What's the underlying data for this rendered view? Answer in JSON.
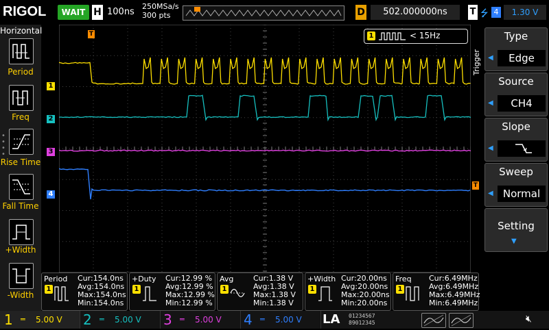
{
  "top": {
    "brand": "RIGOL",
    "status": "WAIT",
    "h_label": "H",
    "timebase": "100ns",
    "sample_rate": "250MSa/s",
    "mem_depth": "300 pts",
    "d_label": "D",
    "delay": "502.000000ns",
    "t_label": "T",
    "trigger_channel": "4",
    "trigger_level": "1.30 V"
  },
  "left_panel": {
    "title": "Horizontal",
    "items": [
      {
        "label": "Period"
      },
      {
        "label": "Freq"
      },
      {
        "label": "Rise Time"
      },
      {
        "label": "Fall Time"
      },
      {
        "label": "+Width"
      },
      {
        "label": "-Width"
      }
    ]
  },
  "screen": {
    "freq_counter_channel": "1",
    "freq_counter_text": "< 15Hz",
    "channel_markers": [
      "1",
      "2",
      "3",
      "4"
    ],
    "trigger_marker": "T",
    "level_marker": "T"
  },
  "right_panel": {
    "side_label": "Trigger",
    "groups": [
      {
        "title": "Type",
        "value": "Edge"
      },
      {
        "title": "Source",
        "value": "CH4"
      },
      {
        "title": "Slope",
        "value": "falling-edge-icon"
      },
      {
        "title": "Sweep",
        "value": "Normal"
      }
    ],
    "setting_label": "Setting"
  },
  "measurements": [
    {
      "name": "Period",
      "channel": "1",
      "cur": "Cur:154.0ns",
      "avg": "Avg:154.0ns",
      "max": "Max:154.0ns",
      "min": "Min:154.0ns"
    },
    {
      "name": "+Duty",
      "channel": "1",
      "cur": "Cur:12.99 %",
      "avg": "Avg:12.99 %",
      "max": "Max:12.99 %",
      "min": "Min:12.99 %"
    },
    {
      "name": "Avg",
      "channel": "1",
      "cur": "Cur:1.38 V",
      "avg": "Avg:1.38 V",
      "max": "Max:1.38 V",
      "min": "Min:1.38 V"
    },
    {
      "name": "+Width",
      "channel": "1",
      "cur": "Cur:20.00ns",
      "avg": "Avg:20.00ns",
      "max": "Max:20.00ns",
      "min": "Min:20.00ns"
    },
    {
      "name": "Freq",
      "channel": "1",
      "cur": "Cur:6.49MHz",
      "avg": "Avg:6.49MHz",
      "max": "Max:6.49MHz",
      "min": "Min:6.49MHz"
    }
  ],
  "bottom": {
    "channels": [
      {
        "num": "1",
        "volts": "5.00 V",
        "color": "#ffe000"
      },
      {
        "num": "2",
        "volts": "5.00 V",
        "color": "#16c0c0"
      },
      {
        "num": "3",
        "volts": "5.00 V",
        "color": "#e040e0"
      },
      {
        "num": "4",
        "volts": "5.00 V",
        "color": "#2f7fff"
      }
    ],
    "la_label": "LA",
    "digital_row1": "01234567",
    "digital_row2": "89012345"
  },
  "colors": {
    "ch1": "#ffe000",
    "ch2": "#16c0c0",
    "ch3": "#e040e0",
    "ch4": "#2f7fff",
    "trigger": "#ff8c00"
  }
}
